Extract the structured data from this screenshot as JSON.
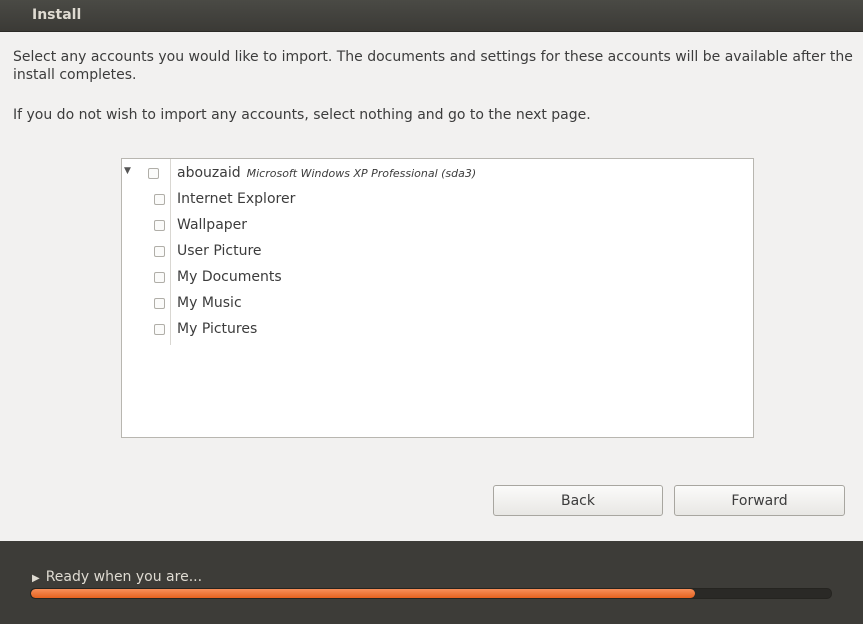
{
  "window": {
    "title": "Install"
  },
  "intro": {
    "line1": "Select any accounts you would like to import.  The documents and settings for these accounts will be available after the install completes.",
    "line2": "If you do not wish to import any accounts, select nothing and go to the next page."
  },
  "tree": {
    "account": {
      "name": "abouzaid",
      "source": "Microsoft Windows XP Professional (sda3)",
      "checked": false,
      "expanded": true
    },
    "items": [
      {
        "label": "Internet Explorer",
        "checked": false
      },
      {
        "label": "Wallpaper",
        "checked": false
      },
      {
        "label": "User Picture",
        "checked": false
      },
      {
        "label": "My Documents",
        "checked": false
      },
      {
        "label": "My Music",
        "checked": false
      },
      {
        "label": "My Pictures",
        "checked": false
      }
    ]
  },
  "buttons": {
    "back": "Back",
    "forward": "Forward"
  },
  "status": {
    "text": "Ready when you are...",
    "progress": 0.83,
    "progress_color": "#e5621f"
  },
  "colors": {
    "titlebar": "#3b3a36",
    "background": "#f2f1f0",
    "accent": "#e5621f"
  }
}
